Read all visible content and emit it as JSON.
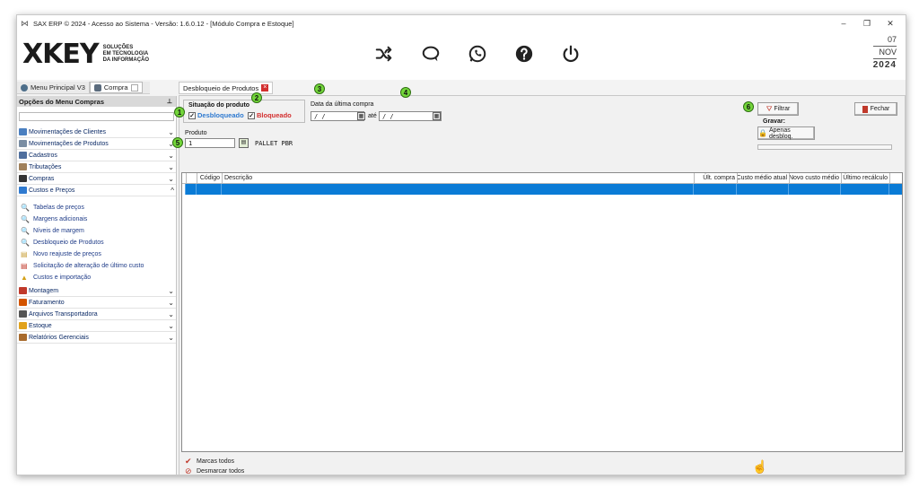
{
  "window": {
    "title": "SAX ERP © 2024 - Acesso ao Sistema - Versão: 1.6.0.12 - [Módulo Compra e Estoque]",
    "controls": [
      "–",
      "❐",
      "✕"
    ]
  },
  "header": {
    "logo_mark": "XKEY",
    "logo_lines": [
      "SOLUÇÕES",
      "EM TECNOLOGIA",
      "DA INFORMAÇÃO"
    ],
    "toolbar_icons": [
      "shuffle-icon",
      "chat-icon",
      "whatsapp-icon",
      "help-icon",
      "power-icon"
    ],
    "date": {
      "day": "07",
      "month": "NOV",
      "year": "2024"
    }
  },
  "top_tabs": [
    {
      "label": "Menu Principal V3",
      "icon": "refresh-icon"
    },
    {
      "label": "Compra",
      "icon": "compra-icon"
    }
  ],
  "sidebar": {
    "heading": "Opções do Menu Compras",
    "pin": "📌",
    "items": [
      {
        "label": "Movimentações de Clientes",
        "icon": "clients-icon",
        "color": "#4a7fc0",
        "chevron": "⌄"
      },
      {
        "label": "Movimentações de Produtos",
        "icon": "products-icon",
        "color": "#7a8da3",
        "chevron": "⌄"
      },
      {
        "label": "Cadastros",
        "icon": "cadastros-icon",
        "color": "#4f6f9e",
        "chevron": "⌄"
      },
      {
        "label": "Tributações",
        "icon": "tax-icon",
        "color": "#a0805a",
        "chevron": "⌄"
      },
      {
        "label": "Compras",
        "icon": "cart-icon",
        "color": "#333333",
        "chevron": "⌄"
      },
      {
        "label": "Custos e Preços",
        "icon": "costs-icon",
        "color": "#2f7ad0",
        "chevron": "^"
      }
    ],
    "sub_items": [
      {
        "label": "Tabelas de preços",
        "icon": "🔍"
      },
      {
        "label": "Margens adicionais",
        "icon": "🔍"
      },
      {
        "label": "Níveis de margem",
        "icon": "🔍"
      },
      {
        "label": "Desbloqueio de Produtos",
        "icon": "🔍"
      },
      {
        "label": "Novo reajuste de preços",
        "icon": "▤"
      },
      {
        "label": "Solicitação de alteração de último custo",
        "icon": "▤"
      },
      {
        "label": "Custos e importação",
        "icon": "▲"
      }
    ],
    "items_after": [
      {
        "label": "Montagem",
        "icon": "montagem-icon",
        "color": "#c0392b",
        "chevron": "⌄"
      },
      {
        "label": "Faturamento",
        "icon": "faturamento-icon",
        "color": "#d35400",
        "chevron": "⌄"
      },
      {
        "label": "Arquivos Transportadora",
        "icon": "truck-icon",
        "color": "#555555",
        "chevron": "⌄"
      },
      {
        "label": "Estoque",
        "icon": "estoque-icon",
        "color": "#e1a21c",
        "chevron": "⌄"
      },
      {
        "label": "Relatórios Gerenciais",
        "icon": "reports-icon",
        "color": "#a86a2c",
        "chevron": "⌄"
      }
    ]
  },
  "content": {
    "tab_label": "Desbloqueio de Produtos",
    "situacao_label": "Situação do produto",
    "desbloqueado_label": "Desbloqueado",
    "bloqueado_label": "Bloqueado",
    "desbloqueado_checked": true,
    "bloqueado_checked": true,
    "data_label": "Data da última compra",
    "date_from": " /  /",
    "ate_label": "até",
    "date_to": " /  /",
    "produto_label": "Produto",
    "produto_value": "1",
    "produto_desc": "PALLET PBR",
    "filtrar_label": "Filtrar",
    "fechar_label": "Fechar",
    "gravar_label": "Gravar:",
    "apenas_label": "Apenas desbloq.",
    "badges": [
      "1",
      "2",
      "3",
      "4",
      "5",
      "6"
    ],
    "columns": [
      "",
      "",
      "Código",
      "Descrição",
      "Últ. compra",
      "Custo médio atual",
      "Novo custo médio",
      "Último recálculo"
    ],
    "marcar_todos": "Marcas todos",
    "desmarcar_todos": "Desmarcar todos"
  }
}
